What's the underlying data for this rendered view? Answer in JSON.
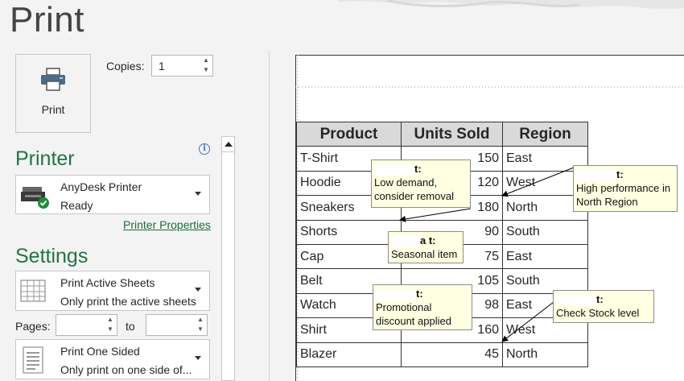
{
  "header": {
    "title": "Print"
  },
  "print_button": {
    "label": "Print"
  },
  "copies": {
    "label": "Copies:",
    "value": "1"
  },
  "printer": {
    "heading": "Printer",
    "name": "AnyDesk Printer",
    "status": "Ready",
    "properties_link": "Printer Properties"
  },
  "settings": {
    "heading": "Settings",
    "sheets": {
      "title": "Print Active Sheets",
      "subtitle": "Only print the active sheets"
    },
    "pages_label": "Pages:",
    "to_label": "to",
    "sided": {
      "title": "Print One Sided",
      "subtitle": "Only print on one side of..."
    }
  },
  "sheet": {
    "headers": [
      "Product",
      "Units Sold",
      "Region"
    ],
    "rows": [
      [
        "T-Shirt",
        "150",
        "East"
      ],
      [
        "Hoodie",
        "120",
        "West"
      ],
      [
        "Sneakers",
        "180",
        "North"
      ],
      [
        "Shorts",
        "90",
        "South"
      ],
      [
        "Cap",
        "75",
        "East"
      ],
      [
        "Belt",
        "105",
        "South"
      ],
      [
        "Watch",
        "98",
        "East"
      ],
      [
        "Shirt",
        "160",
        "West"
      ],
      [
        "Blazer",
        "45",
        "North"
      ]
    ]
  },
  "comments": [
    {
      "author_suffix": "t:",
      "text": "Low demand, consider removal"
    },
    {
      "author_suffix": "t:",
      "text": "High performance in North Region"
    },
    {
      "author_suffix": "a t:",
      "text": "Seasonal item"
    },
    {
      "author_suffix": "t:",
      "text": "Promotional discount applied"
    },
    {
      "author_suffix": "t:",
      "text": "Check Stock level"
    }
  ],
  "colors": {
    "accent": "#217346",
    "link": "#1e6b3c",
    "comment_bg": "#ffffe1"
  }
}
